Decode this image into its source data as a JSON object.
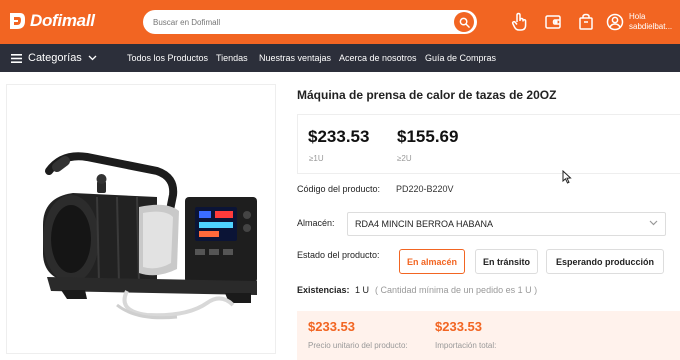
{
  "header": {
    "brand": "Dofimall",
    "search_placeholder": "Buscar en Dofimall",
    "user_greeting": "Hola",
    "user_name": "sabdielbat..."
  },
  "nav": {
    "categories_label": "Categorías",
    "items": [
      "Todos los Productos",
      "Tiendas",
      "Nuestras ventajas",
      "Acerca de nosotros",
      "Guía de Compras"
    ]
  },
  "product": {
    "title": "Máquina de prensa de calor de tazas de 20OZ",
    "prices": [
      {
        "amount": "$233.53",
        "qty": "≥1U"
      },
      {
        "amount": "$155.69",
        "qty": "≥2U"
      }
    ],
    "code_label": "Código del producto:",
    "code_value": "PD220-B220V",
    "warehouse_label": "Almacén:",
    "warehouse_value": "RDA4 MINCIN BERROA HABANA",
    "status_label": "Estado del producto:",
    "status_options": [
      "En almacén",
      "En tránsito",
      "Esperando producción"
    ],
    "status_selected": "En almacén",
    "stock_label": "Existencias:",
    "stock_value": "1 U",
    "stock_note": "( Cantidad mínima de un pedido es 1 U )",
    "unit_price": "$233.53",
    "unit_price_label": "Precio unitario del producto:",
    "total_price": "$233.53",
    "total_price_label": "Importación total:"
  },
  "colors": {
    "brand_orange": "#f26522",
    "nav_dark": "#2c2f3a"
  }
}
